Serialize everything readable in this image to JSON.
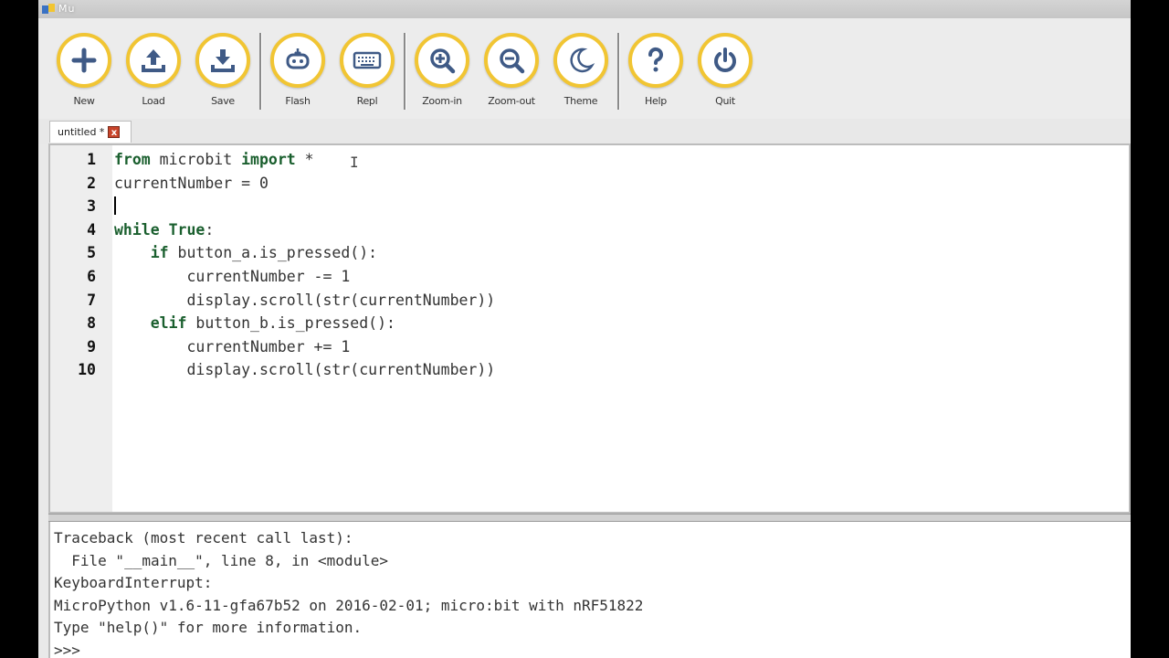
{
  "window": {
    "title": "Mu"
  },
  "toolbar": {
    "buttons": [
      {
        "label": "New",
        "icon": "plus-icon"
      },
      {
        "label": "Load",
        "icon": "upload-icon"
      },
      {
        "label": "Save",
        "icon": "download-icon"
      },
      {
        "label": "Flash",
        "icon": "microbit-icon"
      },
      {
        "label": "Repl",
        "icon": "keyboard-icon"
      },
      {
        "label": "Zoom-in",
        "icon": "zoom-in-icon"
      },
      {
        "label": "Zoom-out",
        "icon": "zoom-out-icon"
      },
      {
        "label": "Theme",
        "icon": "moon-icon"
      },
      {
        "label": "Help",
        "icon": "question-icon"
      },
      {
        "label": "Quit",
        "icon": "power-icon"
      }
    ],
    "accent_color": "#f1c533"
  },
  "tabs": [
    {
      "title": "untitled *",
      "close": "x"
    }
  ],
  "editor": {
    "keyword_color": "#1a5f2e",
    "lines": [
      {
        "num": "1",
        "indent": "",
        "kw": "from",
        "text": " microbit ",
        "kw2": "import",
        "tail": " *"
      },
      {
        "num": "2",
        "indent": "",
        "kw": "",
        "text": "currentNumber = 0",
        "kw2": "",
        "tail": ""
      },
      {
        "num": "3",
        "indent": "",
        "kw": "",
        "text": "",
        "kw2": "",
        "tail": ""
      },
      {
        "num": "4",
        "indent": "",
        "kw": "while",
        "text": " ",
        "kw2": "True",
        "tail": ":"
      },
      {
        "num": "5",
        "indent": "    ",
        "kw": "if",
        "text": " button_a.is_pressed():",
        "kw2": "",
        "tail": ""
      },
      {
        "num": "6",
        "indent": "        ",
        "kw": "",
        "text": "currentNumber -= 1",
        "kw2": "",
        "tail": ""
      },
      {
        "num": "7",
        "indent": "        ",
        "kw": "",
        "text": "display.scroll(str(currentNumber))",
        "kw2": "",
        "tail": ""
      },
      {
        "num": "8",
        "indent": "    ",
        "kw": "elif",
        "text": " button_b.is_pressed():",
        "kw2": "",
        "tail": ""
      },
      {
        "num": "9",
        "indent": "        ",
        "kw": "",
        "text": "currentNumber += 1",
        "kw2": "",
        "tail": ""
      },
      {
        "num": "10",
        "indent": "        ",
        "kw": "",
        "text": "display.scroll(str(currentNumber))",
        "kw2": "",
        "tail": ""
      }
    ]
  },
  "repl": {
    "lines": [
      "Traceback (most recent call last):",
      "  File \"__main__\", line 8, in <module>",
      "KeyboardInterrupt:",
      "MicroPython v1.6-11-gfa67b52 on 2016-02-01; micro:bit with nRF51822",
      "Type \"help()\" for more information.",
      ">>>"
    ]
  }
}
